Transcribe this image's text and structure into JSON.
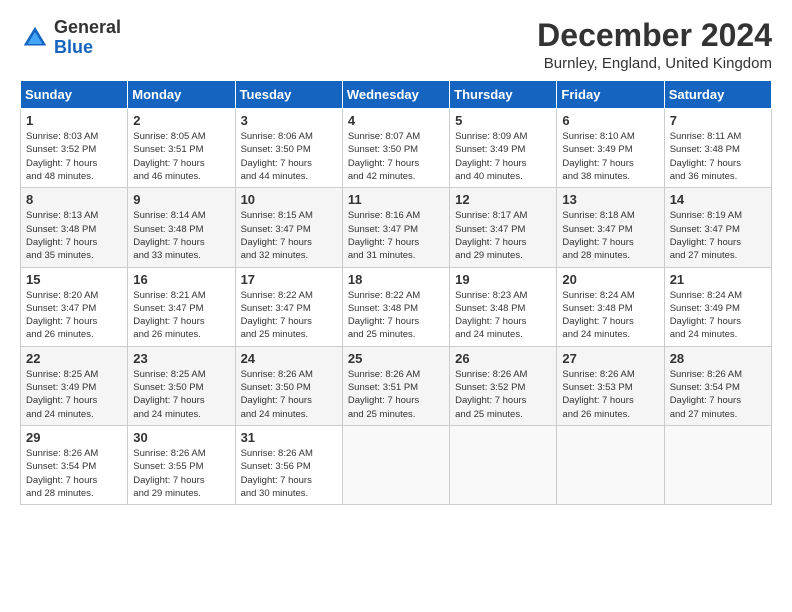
{
  "logo": {
    "line1": "General",
    "line2": "Blue"
  },
  "title": "December 2024",
  "subtitle": "Burnley, England, United Kingdom",
  "headers": [
    "Sunday",
    "Monday",
    "Tuesday",
    "Wednesday",
    "Thursday",
    "Friday",
    "Saturday"
  ],
  "weeks": [
    [
      {
        "day": "1",
        "info": "Sunrise: 8:03 AM\nSunset: 3:52 PM\nDaylight: 7 hours\nand 48 minutes."
      },
      {
        "day": "2",
        "info": "Sunrise: 8:05 AM\nSunset: 3:51 PM\nDaylight: 7 hours\nand 46 minutes."
      },
      {
        "day": "3",
        "info": "Sunrise: 8:06 AM\nSunset: 3:50 PM\nDaylight: 7 hours\nand 44 minutes."
      },
      {
        "day": "4",
        "info": "Sunrise: 8:07 AM\nSunset: 3:50 PM\nDaylight: 7 hours\nand 42 minutes."
      },
      {
        "day": "5",
        "info": "Sunrise: 8:09 AM\nSunset: 3:49 PM\nDaylight: 7 hours\nand 40 minutes."
      },
      {
        "day": "6",
        "info": "Sunrise: 8:10 AM\nSunset: 3:49 PM\nDaylight: 7 hours\nand 38 minutes."
      },
      {
        "day": "7",
        "info": "Sunrise: 8:11 AM\nSunset: 3:48 PM\nDaylight: 7 hours\nand 36 minutes."
      }
    ],
    [
      {
        "day": "8",
        "info": "Sunrise: 8:13 AM\nSunset: 3:48 PM\nDaylight: 7 hours\nand 35 minutes."
      },
      {
        "day": "9",
        "info": "Sunrise: 8:14 AM\nSunset: 3:48 PM\nDaylight: 7 hours\nand 33 minutes."
      },
      {
        "day": "10",
        "info": "Sunrise: 8:15 AM\nSunset: 3:47 PM\nDaylight: 7 hours\nand 32 minutes."
      },
      {
        "day": "11",
        "info": "Sunrise: 8:16 AM\nSunset: 3:47 PM\nDaylight: 7 hours\nand 31 minutes."
      },
      {
        "day": "12",
        "info": "Sunrise: 8:17 AM\nSunset: 3:47 PM\nDaylight: 7 hours\nand 29 minutes."
      },
      {
        "day": "13",
        "info": "Sunrise: 8:18 AM\nSunset: 3:47 PM\nDaylight: 7 hours\nand 28 minutes."
      },
      {
        "day": "14",
        "info": "Sunrise: 8:19 AM\nSunset: 3:47 PM\nDaylight: 7 hours\nand 27 minutes."
      }
    ],
    [
      {
        "day": "15",
        "info": "Sunrise: 8:20 AM\nSunset: 3:47 PM\nDaylight: 7 hours\nand 26 minutes."
      },
      {
        "day": "16",
        "info": "Sunrise: 8:21 AM\nSunset: 3:47 PM\nDaylight: 7 hours\nand 26 minutes."
      },
      {
        "day": "17",
        "info": "Sunrise: 8:22 AM\nSunset: 3:47 PM\nDaylight: 7 hours\nand 25 minutes."
      },
      {
        "day": "18",
        "info": "Sunrise: 8:22 AM\nSunset: 3:48 PM\nDaylight: 7 hours\nand 25 minutes."
      },
      {
        "day": "19",
        "info": "Sunrise: 8:23 AM\nSunset: 3:48 PM\nDaylight: 7 hours\nand 24 minutes."
      },
      {
        "day": "20",
        "info": "Sunrise: 8:24 AM\nSunset: 3:48 PM\nDaylight: 7 hours\nand 24 minutes."
      },
      {
        "day": "21",
        "info": "Sunrise: 8:24 AM\nSunset: 3:49 PM\nDaylight: 7 hours\nand 24 minutes."
      }
    ],
    [
      {
        "day": "22",
        "info": "Sunrise: 8:25 AM\nSunset: 3:49 PM\nDaylight: 7 hours\nand 24 minutes."
      },
      {
        "day": "23",
        "info": "Sunrise: 8:25 AM\nSunset: 3:50 PM\nDaylight: 7 hours\nand 24 minutes."
      },
      {
        "day": "24",
        "info": "Sunrise: 8:26 AM\nSunset: 3:50 PM\nDaylight: 7 hours\nand 24 minutes."
      },
      {
        "day": "25",
        "info": "Sunrise: 8:26 AM\nSunset: 3:51 PM\nDaylight: 7 hours\nand 25 minutes."
      },
      {
        "day": "26",
        "info": "Sunrise: 8:26 AM\nSunset: 3:52 PM\nDaylight: 7 hours\nand 25 minutes."
      },
      {
        "day": "27",
        "info": "Sunrise: 8:26 AM\nSunset: 3:53 PM\nDaylight: 7 hours\nand 26 minutes."
      },
      {
        "day": "28",
        "info": "Sunrise: 8:26 AM\nSunset: 3:54 PM\nDaylight: 7 hours\nand 27 minutes."
      }
    ],
    [
      {
        "day": "29",
        "info": "Sunrise: 8:26 AM\nSunset: 3:54 PM\nDaylight: 7 hours\nand 28 minutes."
      },
      {
        "day": "30",
        "info": "Sunrise: 8:26 AM\nSunset: 3:55 PM\nDaylight: 7 hours\nand 29 minutes."
      },
      {
        "day": "31",
        "info": "Sunrise: 8:26 AM\nSunset: 3:56 PM\nDaylight: 7 hours\nand 30 minutes."
      },
      null,
      null,
      null,
      null
    ]
  ]
}
